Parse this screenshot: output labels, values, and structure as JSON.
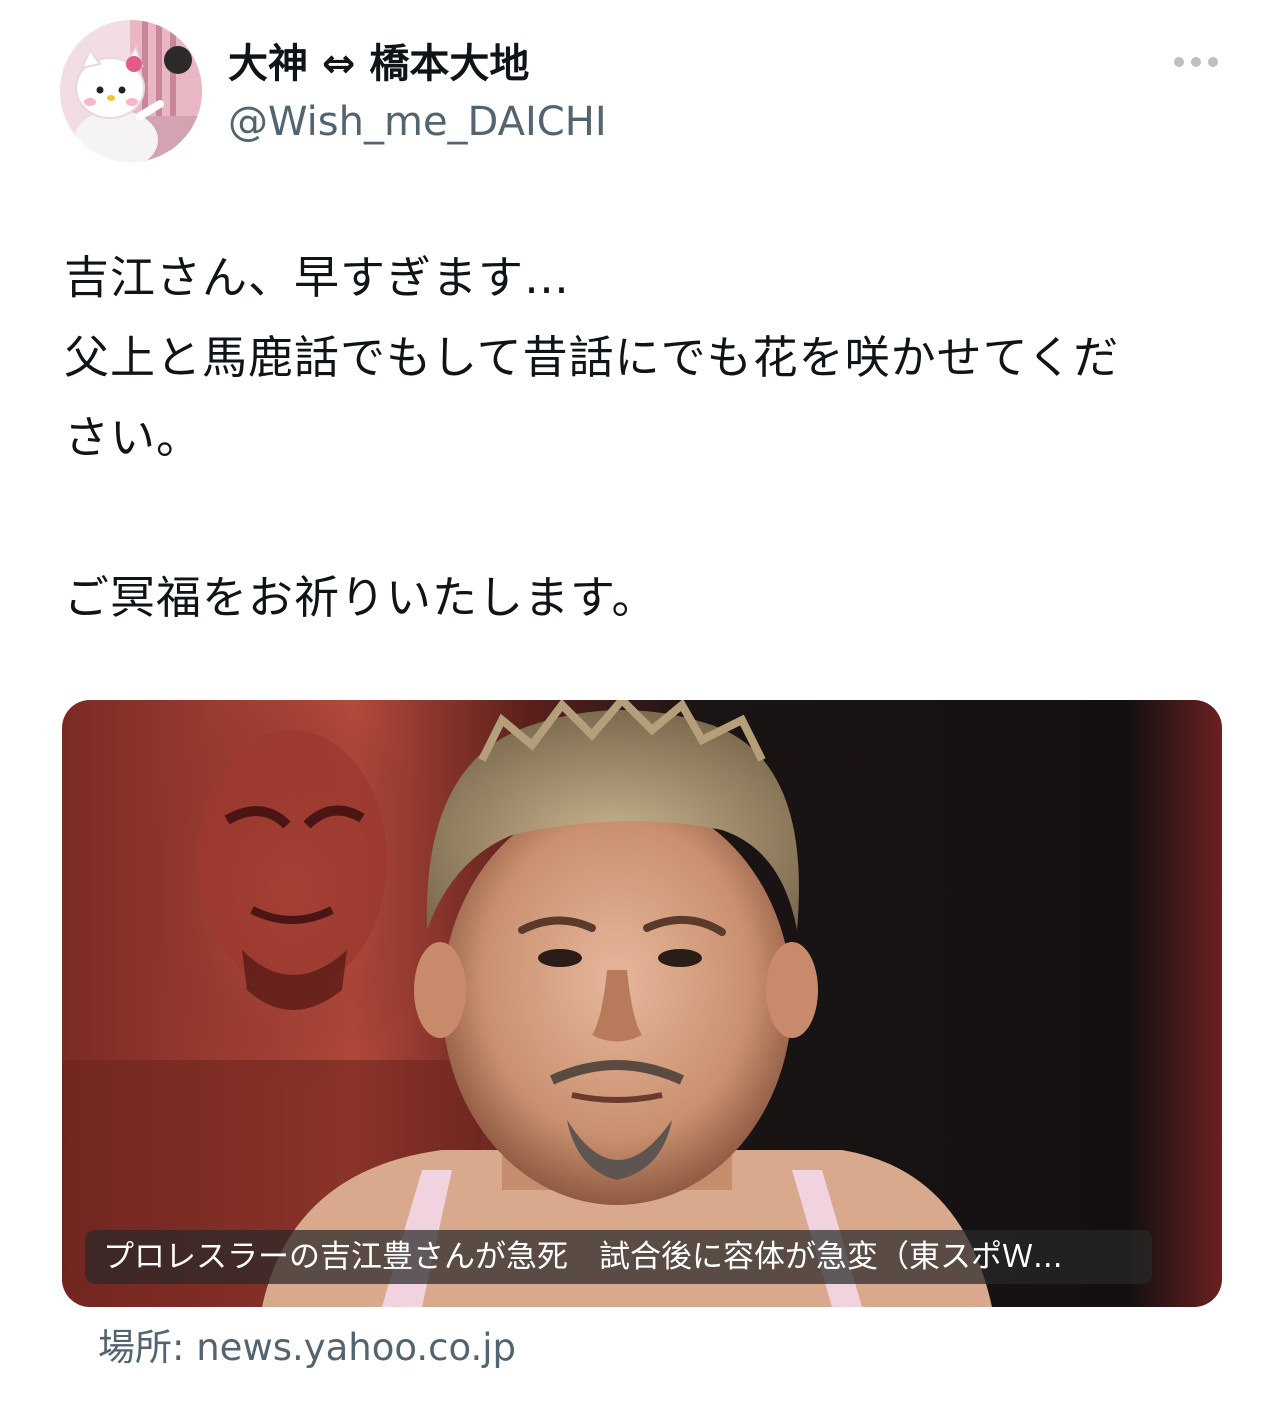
{
  "user": {
    "display_name": "大神 ⇔ 橋本大地",
    "handle": "@Wish_me_DAICHI"
  },
  "tweet": {
    "lines": [
      "吉江さん、早すぎます…",
      "父上と馬鹿話でもして昔話にでも花を咲かせてくだ",
      "さい。",
      "",
      "ご冥福をお祈りいたします。"
    ]
  },
  "card": {
    "caption": "プロレスラーの吉江豊さんが急死　試合後に容体が急変（東スポＷ...",
    "source_label": "場所: news.yahoo.co.jp"
  },
  "icons": {
    "more": "more-horizontal-icon"
  },
  "colors": {
    "text_primary": "#0f1419",
    "text_secondary": "#536471",
    "caption_bg": "#282828"
  }
}
